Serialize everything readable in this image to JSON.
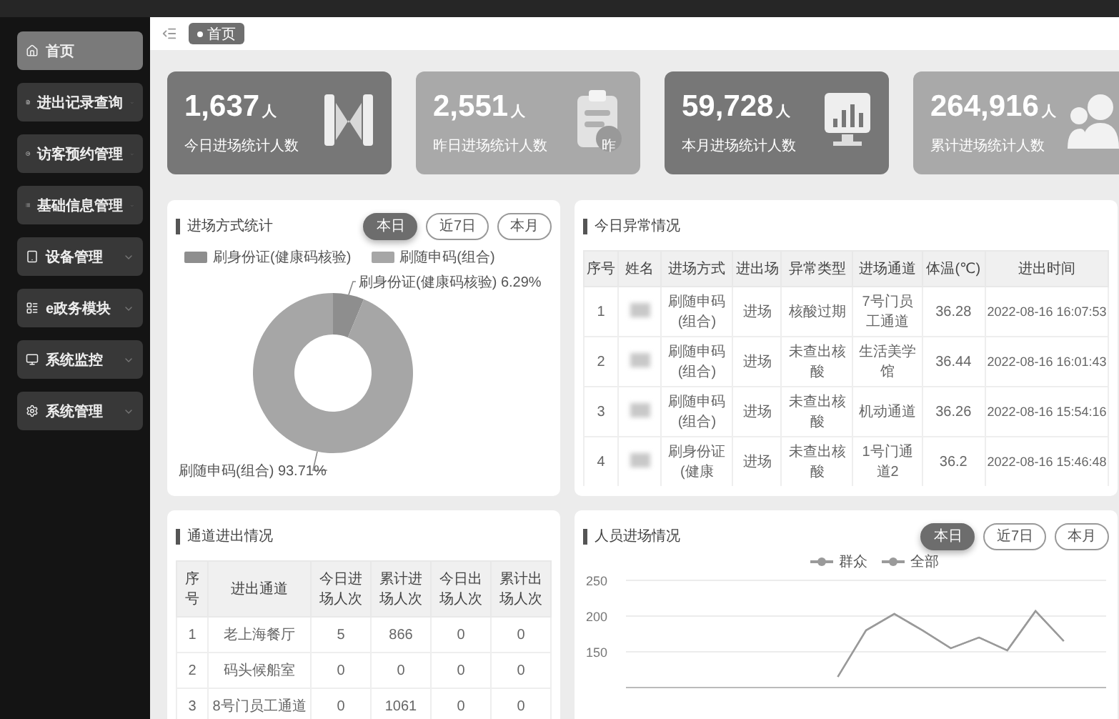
{
  "sidebar": {
    "items": [
      {
        "label": "首页",
        "selected": true,
        "expandable": false
      },
      {
        "label": "进出记录查询",
        "selected": false,
        "expandable": true
      },
      {
        "label": "访客预约管理",
        "selected": false,
        "expandable": true
      },
      {
        "label": "基础信息管理",
        "selected": false,
        "expandable": true
      },
      {
        "label": "设备管理",
        "selected": false,
        "expandable": true
      },
      {
        "label": "e政务模块",
        "selected": false,
        "expandable": true
      },
      {
        "label": "系统监控",
        "selected": false,
        "expandable": true
      },
      {
        "label": "系统管理",
        "selected": false,
        "expandable": true
      }
    ]
  },
  "tabs": [
    {
      "label": "首页",
      "selected": true
    }
  ],
  "cards": [
    {
      "value": "1,637",
      "unit": "人",
      "label": "今日进场统计人数",
      "color": "#777777"
    },
    {
      "value": "2,551",
      "unit": "人",
      "label": "昨日进场统计人数",
      "color": "#a9a9a9",
      "badge": "昨"
    },
    {
      "value": "59,728",
      "unit": "人",
      "label": "本月进场统计人数",
      "color": "#777777"
    },
    {
      "value": "264,916",
      "unit": "人",
      "label": "累计进场统计人数",
      "color": "#a9a9a9"
    }
  ],
  "entry_methods": {
    "title": "进场方式统计",
    "range_buttons": [
      {
        "label": "本日",
        "selected": true
      },
      {
        "label": "近7日",
        "selected": false
      },
      {
        "label": "本月",
        "selected": false
      }
    ],
    "chart_data": {
      "type": "donut",
      "categories": [
        "刷身份证(健康码核验)",
        "刷随申码(组合)"
      ],
      "values": [
        6.29,
        93.71
      ],
      "colors": [
        "#8e8e8e",
        "#a6a6a6"
      ],
      "value_labels": [
        "刷身份证(健康码核验) 6.29%",
        "刷随申码(组合) 93.71%"
      ]
    }
  },
  "exceptions": {
    "title": "今日异常情况",
    "columns": [
      "序号",
      "姓名",
      "进场方式",
      "进出场",
      "异常类型",
      "进场通道",
      "体温(℃)",
      "进出时间"
    ],
    "rows": [
      {
        "cells": [
          "1",
          "",
          "刷随申码(组合)",
          "进场",
          "核酸过期",
          "7号门员工通道",
          "36.28",
          "2022-08-16 16:07:53"
        ]
      },
      {
        "cells": [
          "2",
          "",
          "刷随申码(组合)",
          "进场",
          "未查出核酸",
          "生活美学馆",
          "36.44",
          "2022-08-16 16:01:43"
        ]
      },
      {
        "cells": [
          "3",
          "",
          "刷随申码(组合)",
          "进场",
          "未查出核酸",
          "机动通道",
          "36.26",
          "2022-08-16 15:54:16"
        ]
      },
      {
        "cells": [
          "4",
          "",
          "刷身份证(健康",
          "进场",
          "未查出核酸",
          "1号门通道2",
          "36.2",
          "2022-08-16 15:46:48"
        ]
      }
    ]
  },
  "channels": {
    "title": "通道进出情况",
    "columns": [
      "序号",
      "进出通道",
      "今日进场人次",
      "累计进场人次",
      "今日出场人次",
      "累计出场人次"
    ],
    "rows": [
      {
        "cells": [
          "1",
          "老上海餐厅",
          "5",
          "866",
          "0",
          "0"
        ]
      },
      {
        "cells": [
          "2",
          "码头候船室",
          "0",
          "0",
          "0",
          "0"
        ]
      },
      {
        "cells": [
          "3",
          "8号门员工通道",
          "0",
          "1061",
          "0",
          "0"
        ]
      }
    ]
  },
  "entries": {
    "title": "人员进场情况",
    "range_buttons": [
      {
        "label": "本日",
        "selected": true
      },
      {
        "label": "近7日",
        "selected": false
      },
      {
        "label": "本月",
        "selected": false
      }
    ],
    "chart_data": {
      "type": "line",
      "ylim": [
        100,
        250
      ],
      "yticks": [
        150,
        200,
        250
      ],
      "series": [
        {
          "name": "群众",
          "color": "#9a9a9a",
          "values": [
            null,
            null,
            null,
            null,
            null,
            null,
            null,
            115,
            180,
            203,
            180,
            155,
            170,
            152,
            207,
            165,
            null
          ]
        },
        {
          "name": "全部",
          "color": "#9a9a9a",
          "values": [
            null,
            null,
            null,
            null,
            null,
            null,
            null,
            115,
            180,
            203,
            180,
            155,
            170,
            152,
            207,
            165,
            null
          ]
        }
      ]
    }
  }
}
